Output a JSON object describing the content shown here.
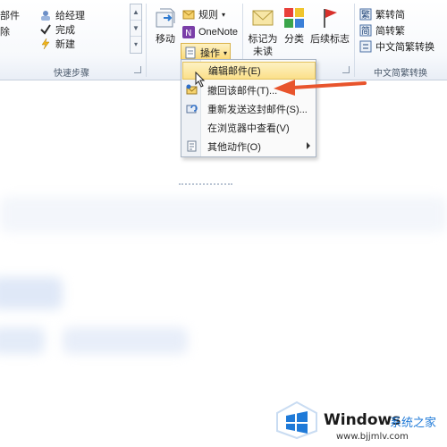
{
  "quick_steps": {
    "items": [
      "部件",
      "除",
      "给经理",
      "完成",
      "新建"
    ],
    "label": "快速步骤"
  },
  "move_group": {
    "move_label": "移动",
    "rules_label": "规则",
    "onenote_label": "OneNote",
    "actions_label": "操作"
  },
  "tags_group": {
    "unread_label": "标记为\n未读",
    "categorize_label": "分类",
    "followup_label": "后续标志"
  },
  "chinese_group": {
    "trad_to_simp": "繁转简",
    "simp_to_trad": "简转繁",
    "conversion": "中文简繁转换",
    "label": "中文简繁转换"
  },
  "actions_menu": {
    "items": [
      {
        "label": "编辑邮件(E)",
        "highlighted": true
      },
      {
        "label": "撤回该邮件(T)...",
        "highlighted": false
      },
      {
        "label": "重新发送这封邮件(S)...",
        "highlighted": false
      },
      {
        "label": "在浏览器中查看(V)",
        "highlighted": false
      },
      {
        "label": "其他动作(O)",
        "highlighted": false
      }
    ]
  },
  "watermark": {
    "brand": "Windows",
    "suffix": "系统之家",
    "url": "www.bjjmlv.com"
  },
  "colors": {
    "accent_arrow": "#e8542c",
    "highlight": "#fbe08a",
    "windows_blue": "#1f7ad8"
  }
}
